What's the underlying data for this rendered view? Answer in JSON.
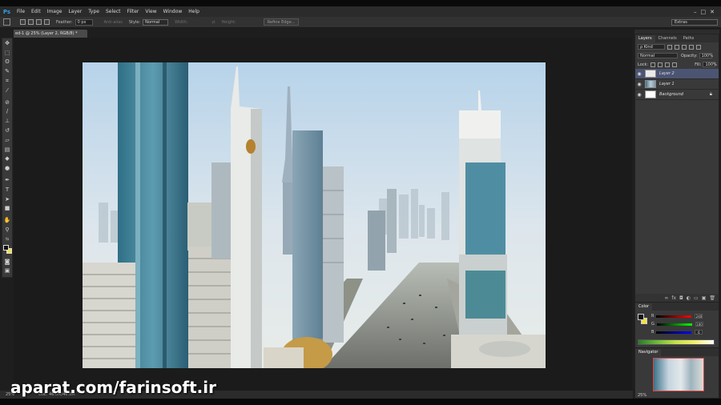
{
  "app": {
    "logo": "Ps",
    "menu": [
      "File",
      "Edit",
      "Image",
      "Layer",
      "Type",
      "Select",
      "Filter",
      "View",
      "Window",
      "Help"
    ],
    "window_controls": [
      "–",
      "□",
      "✕"
    ]
  },
  "options_bar": {
    "feather_label": "Feather:",
    "feather_value": "0 px",
    "anti_alias_label": "Anti-alias",
    "style_label": "Style:",
    "style_value": "Normal",
    "width_label": "Width:",
    "height_label": "Height:",
    "refine_edge": "Refine Edge...",
    "workspace": "Extras"
  },
  "document": {
    "tab_title": "ed-1 @ 25% (Layer 2, RGB/8) *",
    "zoom": "25%",
    "doc_size": "Doc: 46.0M/46.0M"
  },
  "layers_panel": {
    "tabs": [
      "Layers",
      "Channels",
      "Paths"
    ],
    "kind_label": "ρ Kind",
    "blend_mode": "Normal",
    "opacity_label": "Opacity:",
    "opacity_value": "100%",
    "lock_label": "Lock:",
    "fill_label": "Fill:",
    "fill_value": "100%",
    "layers": [
      {
        "name": "Layer 2",
        "selected": true
      },
      {
        "name": "Layer 1",
        "selected": false
      },
      {
        "name": "Background",
        "selected": false,
        "locked": true
      }
    ]
  },
  "color_panel": {
    "tab": "Color",
    "channels": [
      {
        "label": "R",
        "value": "240"
      },
      {
        "label": "G",
        "value": "100"
      },
      {
        "label": "B",
        "value": "6"
      }
    ]
  },
  "navigator_panel": {
    "tab": "Navigator",
    "zoom": "25%"
  },
  "watermark": "aparat.com/farinsoft.ir",
  "colors": {
    "accent_blue": "#2ca3e8",
    "selected_layer": "#4b5573",
    "background_swatch": "#f5e33a"
  }
}
